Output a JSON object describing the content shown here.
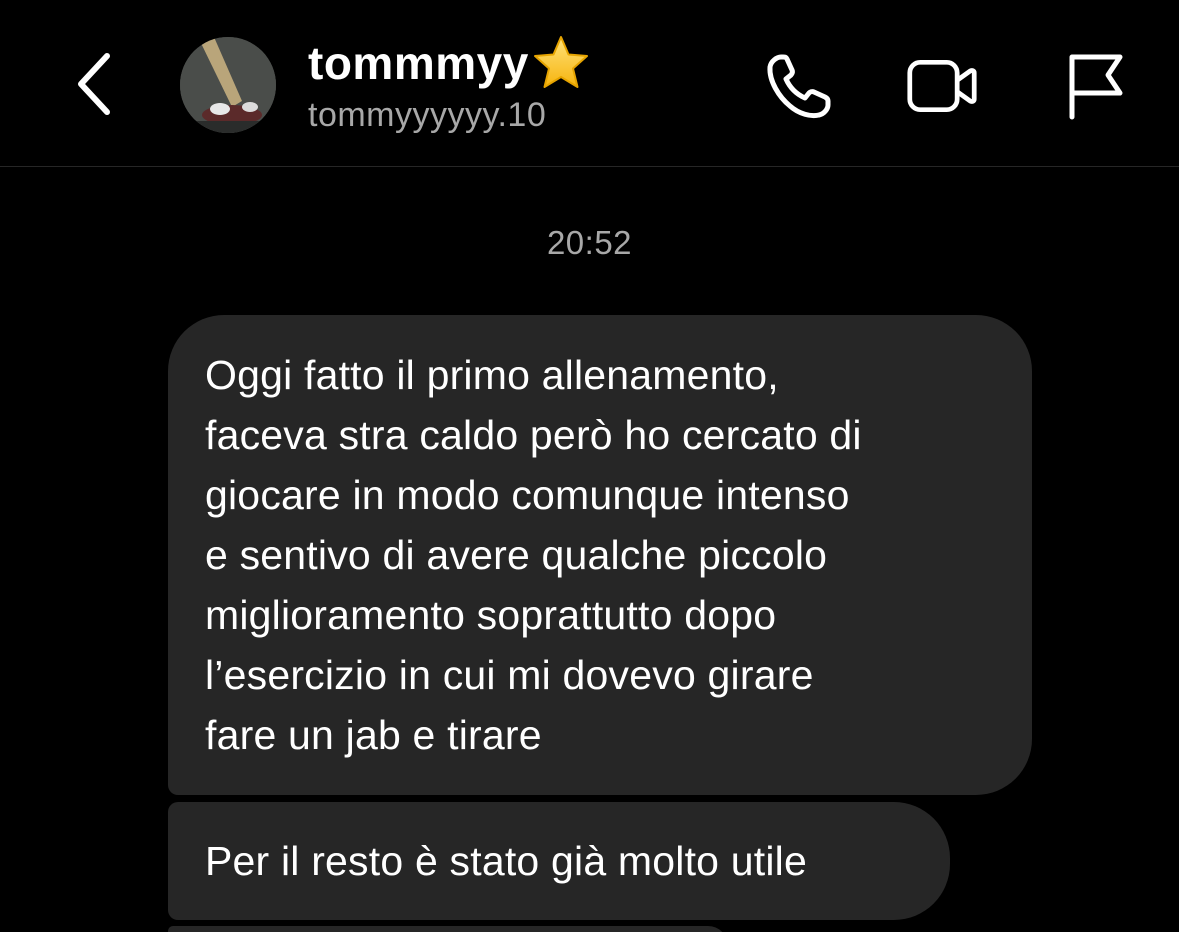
{
  "header": {
    "contact_name": "tommmyy",
    "contact_handle": "tommyyyyyy.10",
    "back_icon": "chevron-left-icon",
    "name_badge_icon": "star-icon",
    "actions": [
      {
        "icon": "phone-icon",
        "label": "Call"
      },
      {
        "icon": "video-camera-icon",
        "label": "Video call"
      },
      {
        "icon": "flag-icon",
        "label": "Report"
      }
    ]
  },
  "conversation": {
    "timestamp": "20:52",
    "messages": [
      {
        "lines": [
          "Oggi fatto il primo allenamento,",
          "faceva stra caldo però ho cercato di",
          "giocare in modo comunque intenso",
          "e sentivo di avere qualche piccolo",
          "miglioramento soprattutto dopo",
          "l’esercizio in cui mi dovevo girare",
          "fare un jab e tirare"
        ]
      },
      {
        "lines": [
          "Per il resto è stato già molto utile"
        ]
      }
    ]
  },
  "colors": {
    "background": "#000000",
    "bubble": "#262626",
    "secondary_text": "#a8a8a8",
    "star": "#ffd43b"
  }
}
